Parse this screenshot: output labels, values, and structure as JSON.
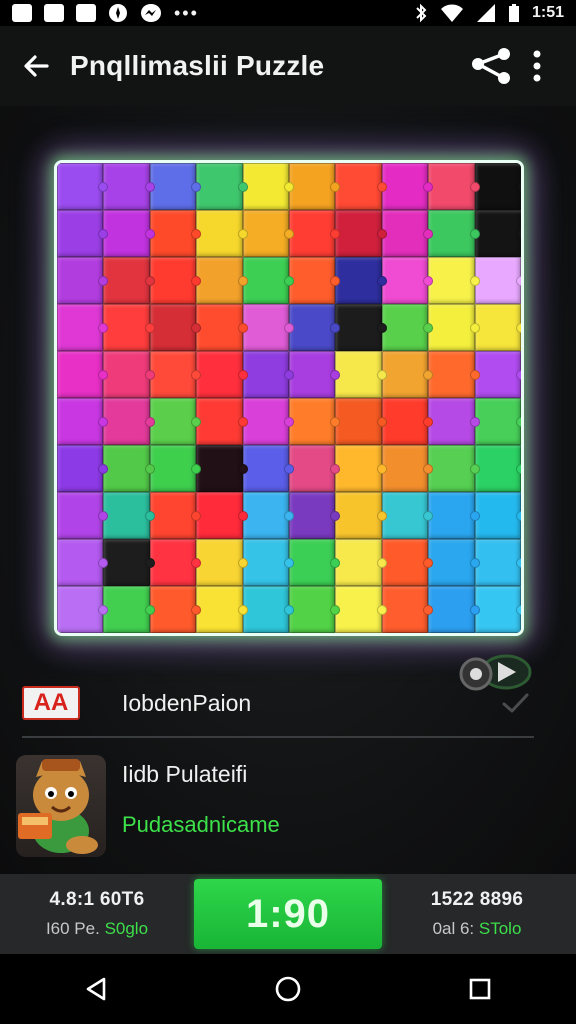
{
  "status_bar": {
    "time": "1:51",
    "dots": "•••",
    "icons": [
      "image-icon",
      "gallery-icon",
      "photo-icon",
      "compass-icon",
      "messenger-icon",
      "bluetooth-icon",
      "wifi-icon",
      "signal-icon",
      "battery-icon"
    ]
  },
  "app_bar": {
    "title": "Pnqllimaslii Puzzle",
    "back_icon": "arrow-left-icon",
    "share_icon": "share-icon",
    "menu_icon": "more-vertical-icon"
  },
  "puzzle": {
    "rows": 10,
    "cols": 10,
    "colors": [
      "#9a4cf0",
      "#a742e8",
      "#5e6ee8",
      "#3fc76d",
      "#f3e932",
      "#f4a321",
      "#ff4a34",
      "#e42cc4",
      "#f24a6b",
      "#101010",
      "#9b3ee6",
      "#c233e0",
      "#ff4a2a",
      "#f6d72c",
      "#f4ad24",
      "#ff3d33",
      "#d0203c",
      "#e32ebc",
      "#3cc85f",
      "#141414",
      "#b23ddf",
      "#e2343e",
      "#ff3b30",
      "#f2a22b",
      "#3dcf53",
      "#ff5d2c",
      "#2e2e9e",
      "#f04bd3",
      "#f7f14a",
      "#e9a8ff",
      "#df38d5",
      "#ff3d3d",
      "#d52e36",
      "#ff4c2e",
      "#e05cd6",
      "#4a4ac8",
      "#1c1c1c",
      "#58d04b",
      "#f4ef3c",
      "#f6e53a",
      "#e82fc6",
      "#f03b7a",
      "#ff4a3a",
      "#ff2f3d",
      "#8f3de0",
      "#a83de0",
      "#f6e84a",
      "#f2a431",
      "#ff6a2c",
      "#b04cf0",
      "#c837e2",
      "#e33a9c",
      "#5bcf4b",
      "#ff3a34",
      "#d93fd9",
      "#ff7d2a",
      "#f45a22",
      "#ff3b2b",
      "#b64ae6",
      "#47cf59",
      "#8c3ae6",
      "#52c948",
      "#3ecf4d",
      "#211015",
      "#5a5ee8",
      "#e44a86",
      "#ffb82c",
      "#f38e2d",
      "#56cf52",
      "#2bd164",
      "#b144e8",
      "#2bbf9e",
      "#ff4530",
      "#ff2a3a",
      "#3bb4f0",
      "#7a3ac0",
      "#f7c42c",
      "#37c7d2",
      "#2aa6f0",
      "#24b9ee",
      "#b45af0",
      "#1d1d1d",
      "#ff3342",
      "#f8d532",
      "#35c3e8",
      "#3ccf55",
      "#f7e94b",
      "#ff5a2a",
      "#2aa7ee",
      "#33bff0",
      "#b96ef4",
      "#42cf50",
      "#ff5a2c",
      "#f9e233",
      "#2ec6d8",
      "#52d246",
      "#f8f14b",
      "#ff5d2d",
      "#2c9ff0",
      "#36c6f2"
    ]
  },
  "watermark": {
    "icon": "od-badge-icon"
  },
  "item_row_1": {
    "badge_text": "AA",
    "label": "IobdenPaion",
    "check_icon": "checkmark-icon"
  },
  "item_row_2": {
    "avatar_icon": "mascot-character-icon",
    "title": "Iidb Pulateifi",
    "subtitle": "Pudasadnicame"
  },
  "bottom_panel": {
    "left_main": "4.8:1 60T6",
    "left_sub_prefix": "I60 Pe.",
    "left_sub_accent": "S0glo",
    "timer": "1:90",
    "right_main": "1522 8896",
    "right_sub_prefix": "0al 6:",
    "right_sub_accent": "STolo"
  },
  "nav_bar": {
    "back_icon": "triangle-back-icon",
    "home_icon": "circle-home-icon",
    "recents_icon": "square-recents-icon"
  }
}
